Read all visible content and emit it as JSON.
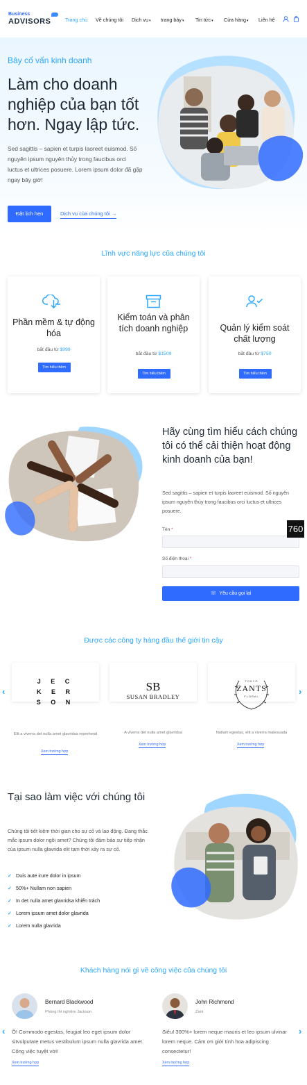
{
  "header": {
    "logo_small": "Business",
    "logo_big": "ADVISORS",
    "nav": [
      {
        "label": "Trang chủ",
        "active": true,
        "caret": false
      },
      {
        "label": "Về chúng tôi",
        "active": false,
        "caret": false
      },
      {
        "label": "Dịch vụ",
        "active": false,
        "caret": true
      },
      {
        "label": "trang bày",
        "active": false,
        "caret": true
      },
      {
        "label": "Tin tức",
        "active": false,
        "caret": true
      },
      {
        "label": "Cửa hàng",
        "active": false,
        "caret": true
      },
      {
        "label": "Liên hệ",
        "active": false,
        "caret": false
      }
    ],
    "caret_glyph": "▾"
  },
  "hero": {
    "eyebrow": "Bây cố vấn kinh doanh",
    "title": "Làm cho doanh nghiệp của bạn tốt hơn. Ngay lập tức.",
    "text": "Sed sagittis – sapien et turpis laoreet euismod. Số nguyên ipsum nguyên thủy trong faucibus orci luctus et ultrices posuere. Lorem ipsum dolor đã gặp ngay bây giờ!",
    "primary_button": "Đặt lịch hẹn",
    "secondary_link": "Dịch vụ của chúng tôi",
    "arrow": "→"
  },
  "capabilities": {
    "title": "Lĩnh vực năng lực của chúng tôi",
    "cards": [
      {
        "icon": "cloud-download-icon",
        "title": "Phần mềm & tự động hóa",
        "price_label": "bắt đầu từ",
        "price": "$999",
        "button": "Tìm hiểu thêm"
      },
      {
        "icon": "archive-box-icon",
        "title": "Kiểm toán và phân tích doanh nghiệp",
        "price_label": "bắt đầu từ",
        "price": "$1509",
        "button": "Tìm hiểu thêm"
      },
      {
        "icon": "user-check-icon",
        "title": "Quản lý kiểm soát chất lượng",
        "price_label": "bắt đầu từ",
        "price": "$750",
        "button": "Tìm hiểu thêm"
      }
    ]
  },
  "callback": {
    "title": "Hãy cùng tìm hiểu cách chúng tôi có thể cải thiện hoạt động kinh doanh của bạn!",
    "text": "Sed sagittis – sapien et turpis laoreet euismod. Số nguyên ipsum nguyên thủy trong faucibus orci luctus et ultrices posuere.",
    "name_label": "Tên",
    "phone_label": "Số điện thoại",
    "required_mark": "*",
    "name_value": "",
    "phone_value": "",
    "submit": "Yêu cầu gọi lại",
    "phone_icon": "☏",
    "badge": "760"
  },
  "clients": {
    "title": "Được các công ty hàng đầu thế giới tin cậy",
    "prev": "‹",
    "next": "›",
    "items": [
      {
        "logo_lines": [
          "J E C",
          "K E R",
          "S O N"
        ],
        "caption": "Elit a viverra det nulla amet glavridsa reprehend",
        "link": "Xem trường hợp"
      },
      {
        "logo_top": "SB",
        "logo_bottom": "SUSAN BRADLEY",
        "caption": "A viverra det nulla amet glavridsa",
        "link": "Xem trường hợp"
      },
      {
        "logo_small": "TOKYO",
        "logo_main": "ZANTS",
        "logo_sub": "FLORAL",
        "caption": "Nullam egestas, elit a viverra malesuada",
        "link": "Xem trường hợp"
      }
    ]
  },
  "why": {
    "title": "Tại sao làm việc với chúng tôi",
    "text": "Chúng tôi tiết kiệm thời gian cho sự cố và lao động. Đang thắc mắc ipsum dolor ngồi amet? Chúng tôi đảm bảo sự tiếp nhận của ipsum nulla glavrida elit tạm thời xảy ra sự cố.",
    "tick": "✓",
    "checks": [
      "Duis aute irure dolor in ipsum",
      "50%+ Nullam non sapien",
      "In det nulla amet glavridsa khiển trách",
      "Lorem ipsum amet dolor glavrida",
      "Lorem nulla glavrida"
    ]
  },
  "testimonials": {
    "title": "Khách hàng nói gì về công việc của chúng tôi",
    "prev": "‹",
    "next": "›",
    "items": [
      {
        "name": "Bernard Blackwood",
        "role": "Phòng thí nghiệm Jackson",
        "quote": "Ồ! Commodo egestas, feugiat leo eget ipsum dolor sitvulputate metus vestibulum ipsum nulla glavrida amet. Công việc tuyệt vời!",
        "link": "Xem trường hợp"
      },
      {
        "name": "John Richmond",
        "role": "Zant",
        "quote": "Siêu! 300%+ lorem neque mauris et leo ipsum ulvinar lorem neque. Cảm ơn giới tính hoa adipiscing consectetur!",
        "link": "Xem trường hợp"
      }
    ]
  },
  "colors": {
    "accent": "#2aa8ff",
    "primary": "#2f6bff",
    "dark": "#1d2733"
  }
}
